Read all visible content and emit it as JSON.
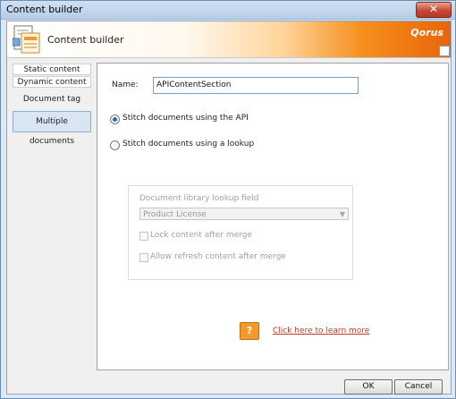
{
  "window": {
    "title": "Content builder",
    "close_glyph": "✕"
  },
  "banner": {
    "title": "Content builder",
    "brand": "Qorus",
    "icon": "content-builder-icon"
  },
  "nav": {
    "items": [
      {
        "label": "Static content",
        "selected": false
      },
      {
        "label": "Dynamic content",
        "selected": false
      },
      {
        "label": "Document tag",
        "selected": false
      },
      {
        "label": "Multiple documents",
        "selected": true
      }
    ]
  },
  "form": {
    "name_label": "Name:",
    "name_value": "APIContentSection",
    "radio_api": {
      "label": "Stitch documents using the API",
      "checked": true
    },
    "radio_lookup": {
      "label": "Stitch documents using a lookup",
      "checked": false
    },
    "lookup_group": {
      "field_label": "Document library lookup field",
      "field_value": "Product License",
      "lock_label": "Lock content after merge",
      "refresh_label": "Allow refresh content after merge"
    }
  },
  "help": {
    "icon_glyph": "?",
    "link_text": "Click here to learn more"
  },
  "footer": {
    "ok_label": "OK",
    "cancel_label": "Cancel"
  },
  "colors": {
    "accent": "#f68f1e",
    "link": "#c0392b",
    "selection": "#d8e6f4"
  }
}
